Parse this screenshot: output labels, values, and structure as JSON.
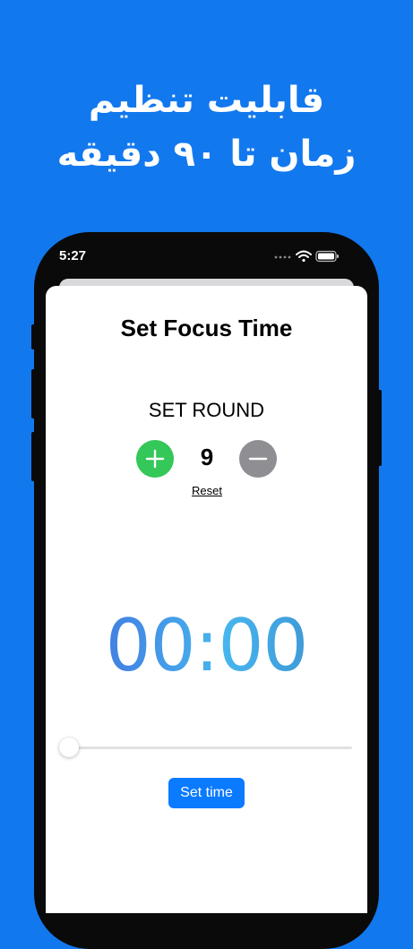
{
  "promo": {
    "line1": "قابلیت تنظیم",
    "line2": "زمان تا ۹۰ دقیقه"
  },
  "status_bar": {
    "time": "5:27",
    "icons": [
      "signal-icon",
      "wifi-icon",
      "battery-icon"
    ]
  },
  "screen": {
    "title": "Set Focus Time",
    "round": {
      "label": "SET ROUND",
      "value": "9",
      "reset_label": "Reset"
    },
    "timer": {
      "display": "00:00"
    },
    "slider": {
      "value": 0
    },
    "set_time_label": "Set time"
  },
  "colors": {
    "background": "#1278ee",
    "plus": "#34c759",
    "minus": "#8e8e93",
    "button": "#0a7aff"
  }
}
